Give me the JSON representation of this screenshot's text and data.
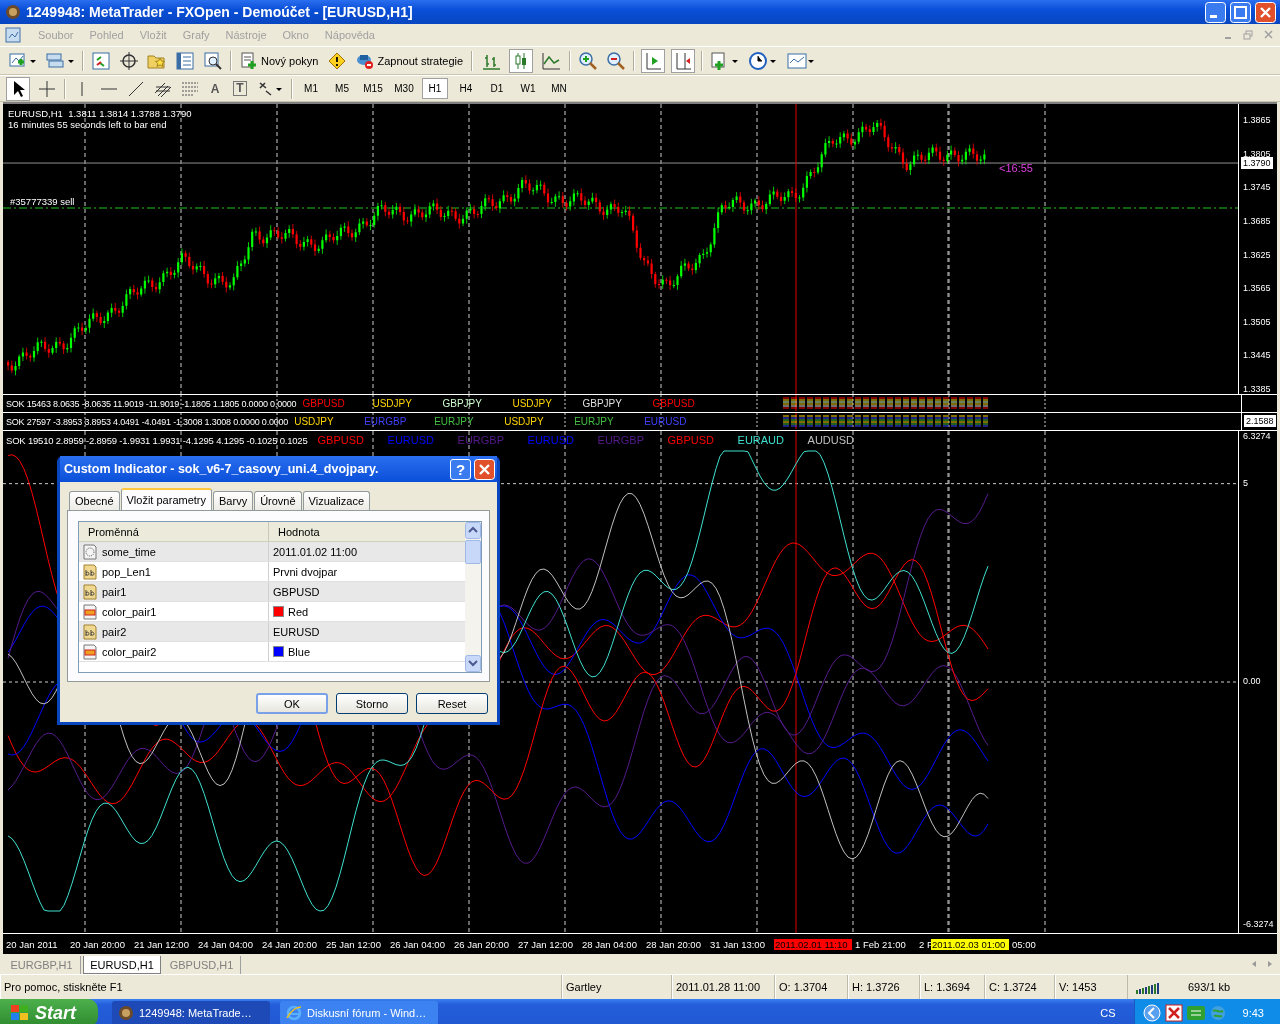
{
  "window": {
    "title": "1249948: MetaTrader - FXOpen - Demoúčet - [EURUSD,H1]"
  },
  "menu": [
    "Soubor",
    "Pohled",
    "Vložit",
    "Grafy",
    "Nástroje",
    "Okno",
    "Nápověda"
  ],
  "toolbar": {
    "new_order": "Nový pokyn",
    "expert_advisors": "Zapnout strategie",
    "chart_types": [
      {
        "selected": false
      },
      {
        "selected": true
      },
      {
        "selected": false
      }
    ],
    "autoscroll": {
      "on": true
    },
    "chart_shift": {
      "on": true
    }
  },
  "drawing_toolbar": {
    "cursor": {
      "selected": true
    },
    "text_tool": "A",
    "label_tool": "T",
    "timeframes": [
      {
        "label": "M1",
        "selected": false
      },
      {
        "label": "M5",
        "selected": false
      },
      {
        "label": "M15",
        "selected": false
      },
      {
        "label": "M30",
        "selected": false
      },
      {
        "label": "H1",
        "selected": true
      },
      {
        "label": "H4",
        "selected": false
      },
      {
        "label": "D1",
        "selected": false
      },
      {
        "label": "W1",
        "selected": false
      },
      {
        "label": "MN",
        "selected": false
      }
    ]
  },
  "chart": {
    "info": "EURUSD,H1  1.3811 1.3814 1.3788 1.3790",
    "countdown": "16 minutes 55 seconds left to bar end",
    "order_label": "#35777339 sell",
    "bar_timer": "<16:55",
    "price_ticks": [
      "1.3865",
      "1.3805",
      "1.3745",
      "1.3685",
      "1.3625",
      "1.3565",
      "1.3505",
      "1.3445",
      "1.3385"
    ],
    "current_price": "1.3790",
    "indicator_rows": [
      {
        "header": "SOK 15463 8.0635 -8.0635 11.9019 -11.9019 -1.1805 1.1805 0.0000 0.0000",
        "pairs": [
          {
            "label": "GBPUSD",
            "color": "#ff0000"
          },
          {
            "label": "USDJPY",
            "color": "#ffd700"
          },
          {
            "label": "GBPJPY",
            "color": "#d0ffd0"
          },
          {
            "label": "USDJPY",
            "color": "#ffd700"
          },
          {
            "label": "GBPJPY",
            "color": "#e0e0e0"
          },
          {
            "label": "GBPUSD",
            "color": "#ff0000"
          }
        ]
      },
      {
        "header": "SOK 27597 -3.8953 3.8953 4.0491 -4.0491 -1.3008 1.3008 0.0000 0.0000",
        "pairs": [
          {
            "label": "USDJPY",
            "color": "#ffd700"
          },
          {
            "label": "EURGBP",
            "color": "#4040ff"
          },
          {
            "label": "EURJPY",
            "color": "#40c040"
          },
          {
            "label": "USDJPY",
            "color": "#ffd700"
          },
          {
            "label": "EURJPY",
            "color": "#40c040"
          },
          {
            "label": "EURUSD",
            "color": "#4040ff"
          }
        ],
        "axis_value": "2.1588"
      }
    ],
    "indicator": {
      "header": "SOK 19510 2.8959 -2.8959 -1.9931 1.9931 -4.1295 4.1295 -0.1025 0.1025",
      "pairs": [
        {
          "label": "GBPUSD",
          "color": "#ff0000"
        },
        {
          "label": "EURUSD",
          "color": "#0000ff"
        },
        {
          "label": "EURGBP",
          "color": "#551a8b"
        },
        {
          "label": "EURUSD",
          "color": "#0000ff"
        },
        {
          "label": "EURGBP",
          "color": "#551a8b"
        },
        {
          "label": "GBPUSD",
          "color": "#ff0000"
        },
        {
          "label": "EURAUD",
          "color": "#40e0d0"
        },
        {
          "label": "AUDUSD",
          "color": "#c0c0c0"
        }
      ],
      "ticks": [
        "6.3274",
        "5",
        "0.00",
        "-6.3274"
      ]
    },
    "time_axis": [
      {
        "kind": "tick",
        "label": "20 Jan 2011"
      },
      {
        "kind": "tick",
        "label": "20 Jan 20:00"
      },
      {
        "kind": "tick",
        "label": "21 Jan 12:00"
      },
      {
        "kind": "tick",
        "label": "24 Jan 04:00"
      },
      {
        "kind": "tick",
        "label": "24 Jan 20:00"
      },
      {
        "kind": "tick",
        "label": "25 Jan 12:00"
      },
      {
        "kind": "tick",
        "label": "26 Jan 04:00"
      },
      {
        "kind": "tick",
        "label": "26 Jan 20:00"
      },
      {
        "kind": "tick",
        "label": "27 Jan 12:00"
      },
      {
        "kind": "tick",
        "label": "28 Jan 04:00"
      },
      {
        "kind": "tick",
        "label": "28 Jan 20:00"
      },
      {
        "kind": "tick",
        "label": "31 Jan 13:00"
      },
      {
        "kind": "marker",
        "label": "2011.02.01 11:10",
        "color": "#ff0000"
      },
      {
        "kind": "tick",
        "label": "1 Feb 21:00"
      },
      {
        "kind": "partial",
        "label": "2 F"
      },
      {
        "kind": "marker",
        "label": "2011.02.03 01:00",
        "color": "#ffff00"
      },
      {
        "kind": "tick",
        "label": "05:00"
      }
    ]
  },
  "dialog": {
    "title": "Custom Indicator - sok_v6-7_casovy_uni.4_dvojpary.",
    "help": "?",
    "tabs": [
      {
        "label": "Obecné",
        "selected": false
      },
      {
        "label": "Vložit parametry",
        "selected": true
      },
      {
        "label": "Barvy",
        "selected": false
      },
      {
        "label": "Úrovně",
        "selected": false
      },
      {
        "label": "Vizualizace",
        "selected": false
      }
    ],
    "columns": [
      "Proměnná",
      "Hodnota"
    ],
    "rows": [
      {
        "kind": "time",
        "name": "some_time",
        "value": "2011.01.02 11:00"
      },
      {
        "kind": "text",
        "name": "pop_Len1",
        "value": "Prvni dvojpar"
      },
      {
        "kind": "text",
        "name": "pair1",
        "value": "GBPUSD"
      },
      {
        "kind": "color",
        "name": "color_pair1",
        "value": "Red",
        "color": "#ff0000"
      },
      {
        "kind": "text",
        "name": "pair2",
        "value": "EURUSD"
      },
      {
        "kind": "color",
        "name": "color_pair2",
        "value": "Blue",
        "color": "#0000ff"
      }
    ],
    "buttons": [
      "OK",
      "Storno",
      "Reset"
    ]
  },
  "chart_tabs": [
    {
      "label": "EURGBP,H1",
      "selected": false
    },
    {
      "label": "EURUSD,H1",
      "selected": true
    },
    {
      "label": "GBPUSD,H1",
      "selected": false
    }
  ],
  "status_bar": {
    "help": "Pro pomoc, stiskněte F1",
    "fields": [
      "Gartley",
      "2011.01.28 11:00",
      "O: 1.3704",
      "H: 1.3726",
      "L: 1.3694",
      "C: 1.3724",
      "V: 1453"
    ],
    "traffic": "693/1 kb"
  },
  "taskbar": {
    "start": "Start",
    "tasks": [
      {
        "label": "1249948: MetaTrade…",
        "selected": true
      },
      {
        "label": "Diskusní fórum - Wind…",
        "selected": false
      }
    ],
    "language": "CS",
    "clock": "9:43"
  }
}
